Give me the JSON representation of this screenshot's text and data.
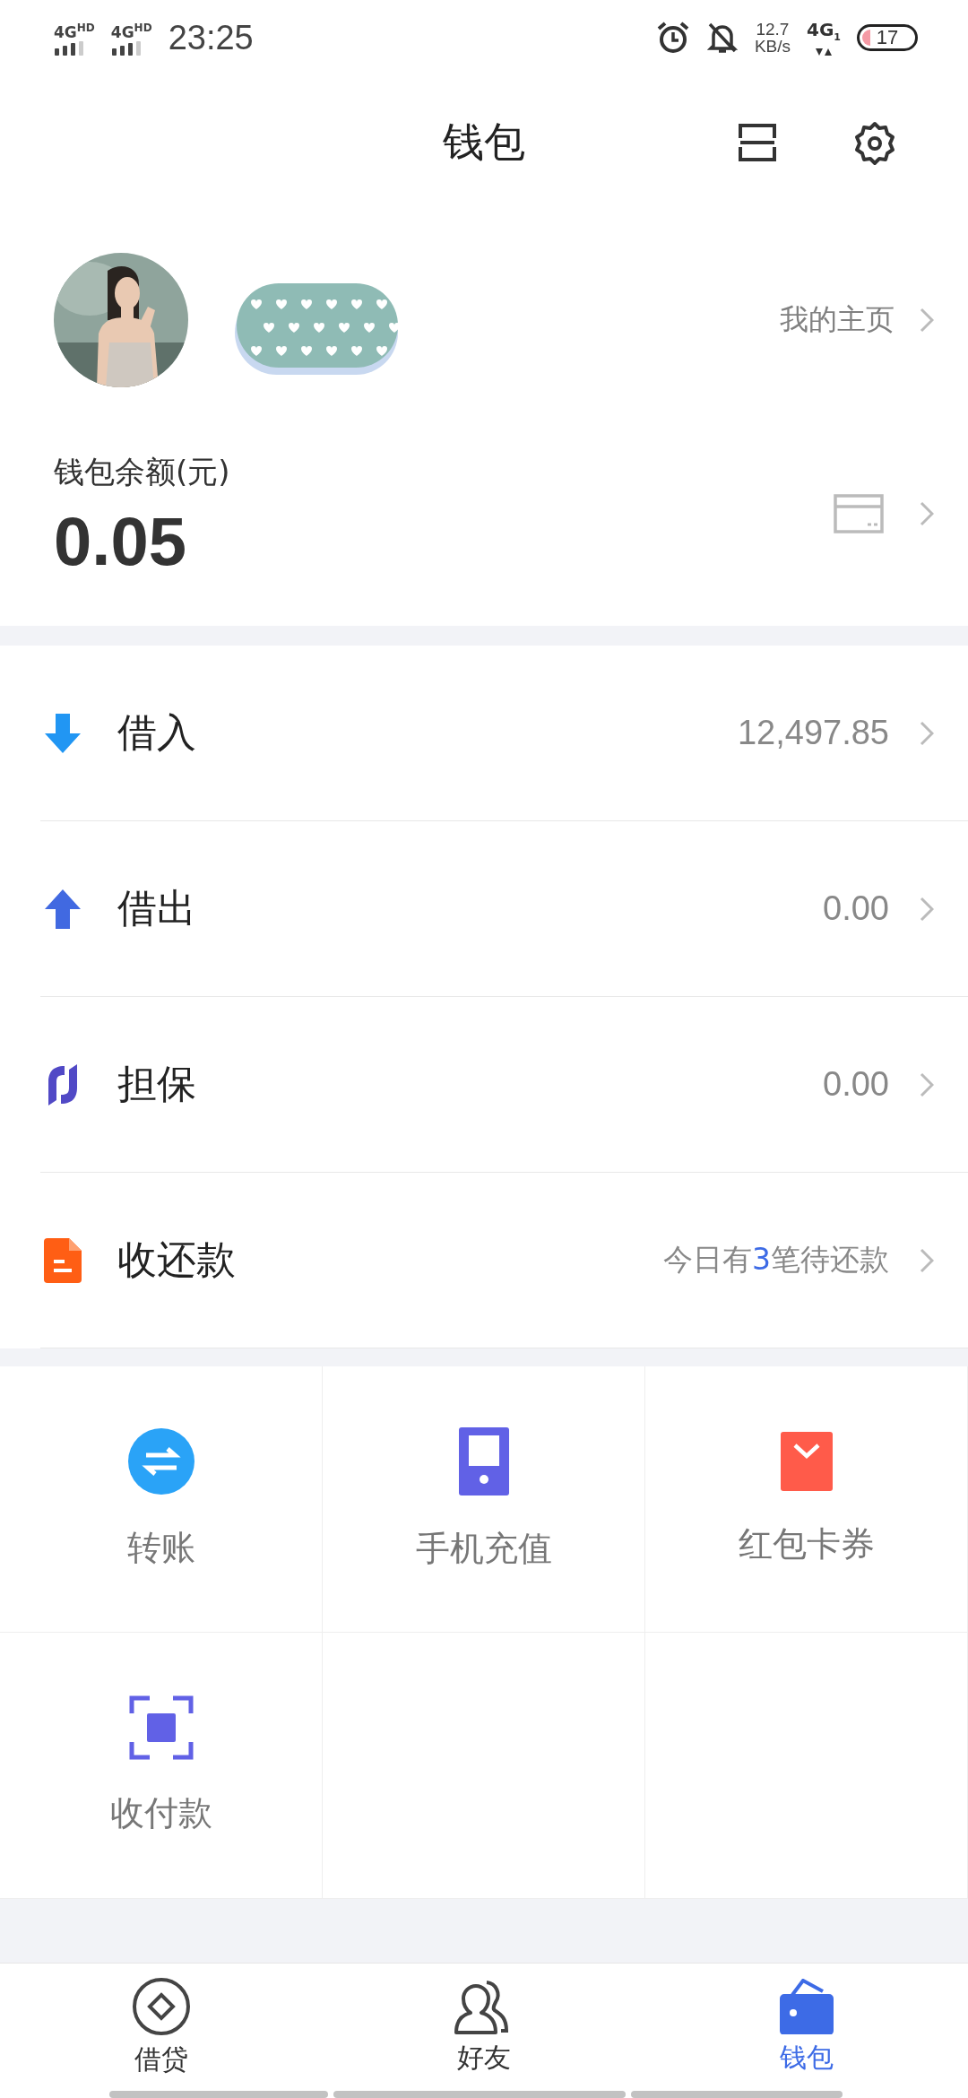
{
  "status_bar": {
    "signals": [
      {
        "network": "4G",
        "badge": "HD"
      },
      {
        "network": "4G",
        "badge": "HD"
      }
    ],
    "time": "23:25",
    "speed_value": "12.7",
    "speed_unit": "KB/s",
    "network": "4G",
    "sim": "1",
    "battery": "17"
  },
  "header": {
    "title": "钱包"
  },
  "profile": {
    "homepage_link": "我的主页"
  },
  "balance": {
    "label": "钱包余额(元)",
    "amount": "0.05"
  },
  "accounts": [
    {
      "kind": "borrow-in",
      "label": "借入",
      "value": "12,497.85"
    },
    {
      "kind": "lend-out",
      "label": "借出",
      "value": "0.00"
    },
    {
      "kind": "guarantee",
      "label": "担保",
      "value": "0.00"
    },
    {
      "kind": "repayment",
      "label": "收还款",
      "value": "今日有**3**笔待还款"
    }
  ],
  "services": [
    {
      "kind": "transfer",
      "label": "转账"
    },
    {
      "kind": "phone",
      "label": "手机充值"
    },
    {
      "kind": "coupon",
      "label": "红包卡券"
    },
    {
      "kind": "scan",
      "label": "收付款"
    }
  ],
  "tabs": [
    {
      "kind": "loan",
      "label": "借贷",
      "selected": false
    },
    {
      "kind": "friends",
      "label": "好友",
      "selected": false
    },
    {
      "kind": "wallet",
      "label": "钱包",
      "selected": true
    }
  ]
}
